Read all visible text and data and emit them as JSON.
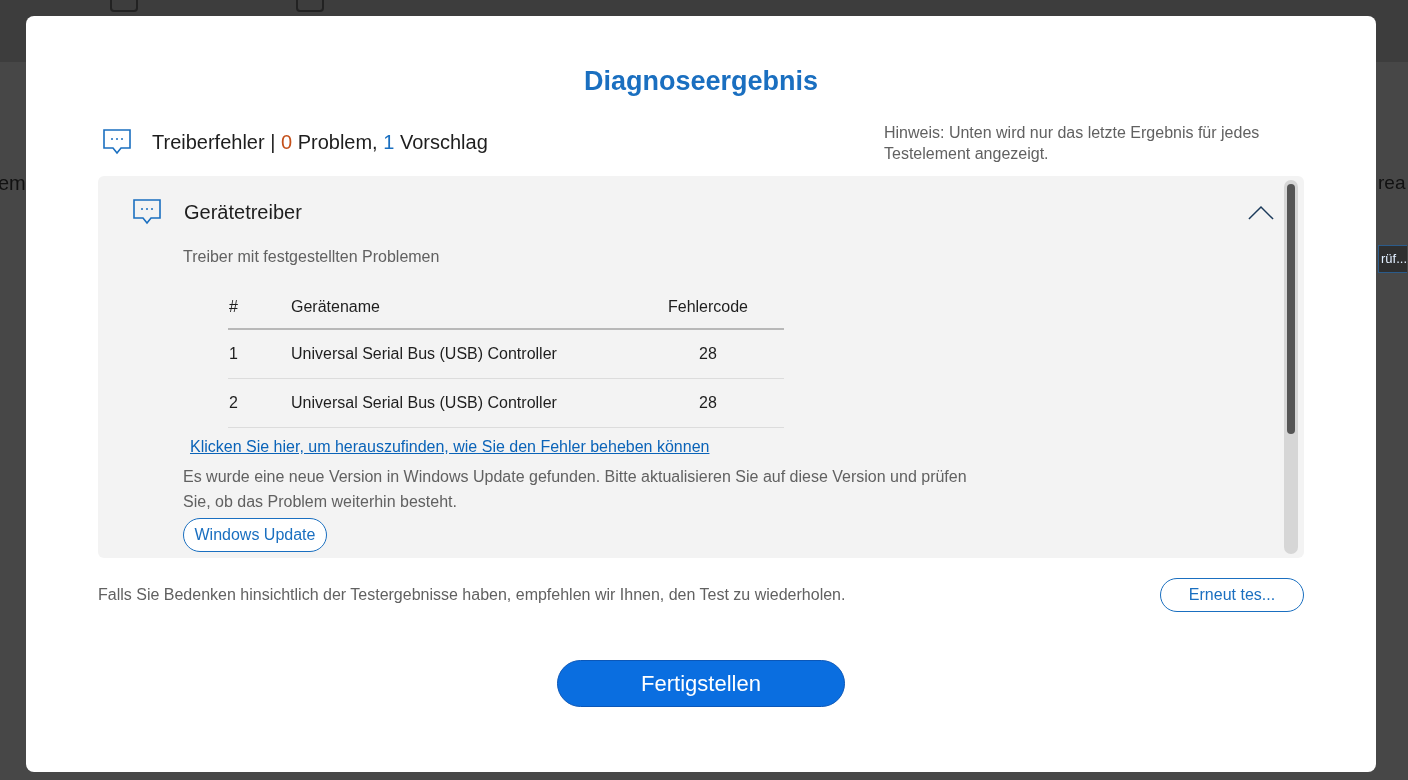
{
  "background": {
    "checkboxes": [
      {
        "checked": false
      },
      {
        "checked": false
      }
    ],
    "left_text": "em",
    "right_text": "rea",
    "right_button": "rüf..."
  },
  "dialog": {
    "title": "Diagnoseergebnis",
    "summary": {
      "category": "Treiberfehler |",
      "problem_count": "0",
      "problem_label": "Problem,",
      "suggestion_count": "1",
      "suggestion_label": "Vorschlag"
    },
    "hint": "Hinweis: Unten wird nur das letzte Ergebnis für jedes Testelement angezeigt.",
    "section": {
      "title": "Gerätetreiber",
      "expanded": true,
      "subtitle": "Treiber mit festgestellten Problemen",
      "table": {
        "columns": [
          "#",
          "Gerätename",
          "Fehlercode"
        ],
        "rows": [
          {
            "cells": [
              "1",
              "Universal Serial Bus (USB) Controller",
              "28"
            ]
          },
          {
            "cells": [
              "2",
              "Universal Serial Bus (USB) Controller",
              "28"
            ]
          }
        ]
      },
      "link": "Klicken Sie hier, um herauszufinden, wie Sie den Fehler beheben können",
      "description": "Es wurde eine neue Version in Windows Update gefunden. Bitte aktualisieren Sie auf diese Version und prüfen Sie, ob das Problem weiterhin besteht.",
      "action_button": "Windows Update"
    },
    "footer_text": "Falls Sie Bedenken hinsichtlich der Testergebnisse haben, empfehlen wir Ihnen, den Test zu wiederholen.",
    "retest_button": "Erneut tes...",
    "finish_button": "Fertigstellen"
  }
}
